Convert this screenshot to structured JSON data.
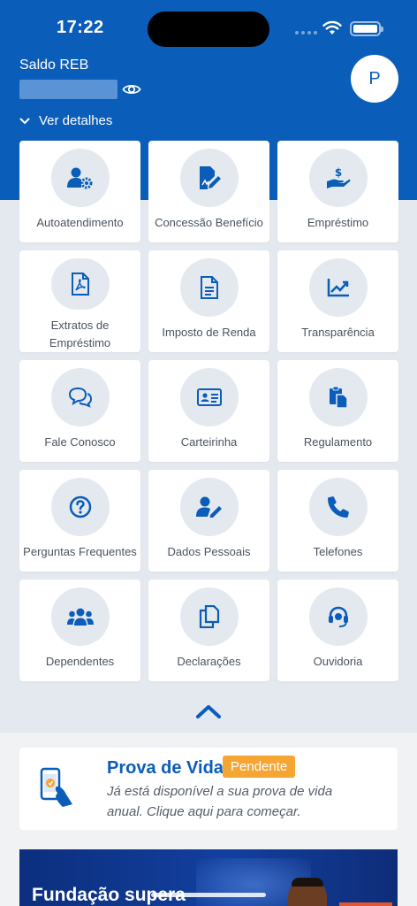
{
  "status_bar": {
    "time": "17:22"
  },
  "header": {
    "balance_label": "Saldo REB",
    "avatar_initial": "P",
    "details_label": "Ver detalhes"
  },
  "menu": [
    {
      "label": "Autoatendimento",
      "icon": "user-gear-icon"
    },
    {
      "label": "Concessão Benefício",
      "icon": "document-sign-icon"
    },
    {
      "label": "Empréstimo",
      "icon": "hand-money-icon"
    },
    {
      "label": "Extratos de Empréstimo",
      "icon": "pdf-file-icon"
    },
    {
      "label": "Imposto de Renda",
      "icon": "document-icon"
    },
    {
      "label": "Transparência",
      "icon": "trend-chart-icon"
    },
    {
      "label": "Fale Conosco",
      "icon": "chat-bubbles-icon"
    },
    {
      "label": "Carteirinha",
      "icon": "id-card-icon"
    },
    {
      "label": "Regulamento",
      "icon": "clipboard-icon"
    },
    {
      "label": "Perguntas Frequentes",
      "icon": "question-circle-icon"
    },
    {
      "label": "Dados Pessoais",
      "icon": "user-edit-icon"
    },
    {
      "label": "Telefones",
      "icon": "phone-icon"
    },
    {
      "label": "Dependentes",
      "icon": "users-icon"
    },
    {
      "label": "Declarações",
      "icon": "copy-icon"
    },
    {
      "label": "Ouvidoria",
      "icon": "headset-icon"
    }
  ],
  "proof_of_life": {
    "title": "Prova de Vida",
    "badge": "Pendente",
    "description": "Já está disponível a sua prova de vida anual. Clique aqui para começar."
  },
  "banner": {
    "text": "Fundação supera"
  },
  "colors": {
    "brand": "#0a5db8",
    "pending": "#f5a531"
  }
}
